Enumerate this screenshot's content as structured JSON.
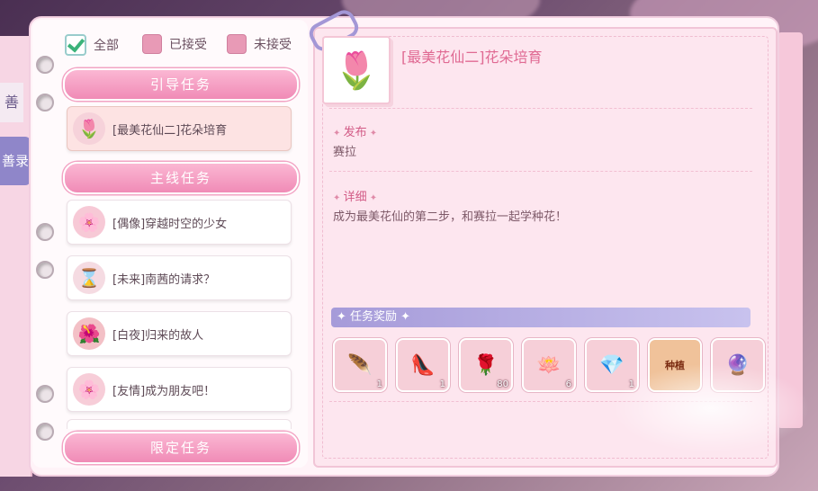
{
  "filters": [
    {
      "label": "全部",
      "checked": true
    },
    {
      "label": "已接受",
      "checked": false
    },
    {
      "label": "未接受",
      "checked": false
    }
  ],
  "side_tabs": {
    "top": "善",
    "record": "善录"
  },
  "sections": {
    "guide": "引导任务",
    "main": "主线任务",
    "limited": "限定任务"
  },
  "quests": {
    "guide": [
      {
        "title": "[最美花仙二]花朵培育",
        "icon": "flower-bud-icon",
        "active": true
      }
    ],
    "main": [
      {
        "title": "[偶像]穿越时空的少女",
        "icon": "pink-flower-icon"
      },
      {
        "title": "[未来]南茜的请求？",
        "icon": "hourglass-icon"
      },
      {
        "title": "[白夜]归来的故人",
        "icon": "red-lily-icon"
      },
      {
        "title": "[友情]成为朋友吧！",
        "icon": "sakura-icon"
      }
    ]
  },
  "detail": {
    "title": "[最美花仙二]花朵培育",
    "publisher_label": "发布",
    "publisher": "赛拉",
    "detail_label": "详细",
    "description": "成为最美花仙的第二步，和赛拉一起学种花！",
    "rewards_label": "任务奖励",
    "rewards": [
      {
        "icon": "feather-wand-icon",
        "count": "1"
      },
      {
        "icon": "shoes-icon",
        "count": "1"
      },
      {
        "icon": "red-rose-icon",
        "count": "80"
      },
      {
        "icon": "lotus-icon",
        "count": "6"
      },
      {
        "icon": "purple-gem-icon",
        "count": "1"
      },
      {
        "icon": "planting-book-icon",
        "count": "",
        "text": "种植"
      },
      {
        "icon": "crystal-icon",
        "count": ""
      }
    ]
  },
  "colors": {
    "accent_pink": "#f08bb6",
    "title_pink": "#e06a93",
    "reward_bar": "#a69bd9"
  }
}
